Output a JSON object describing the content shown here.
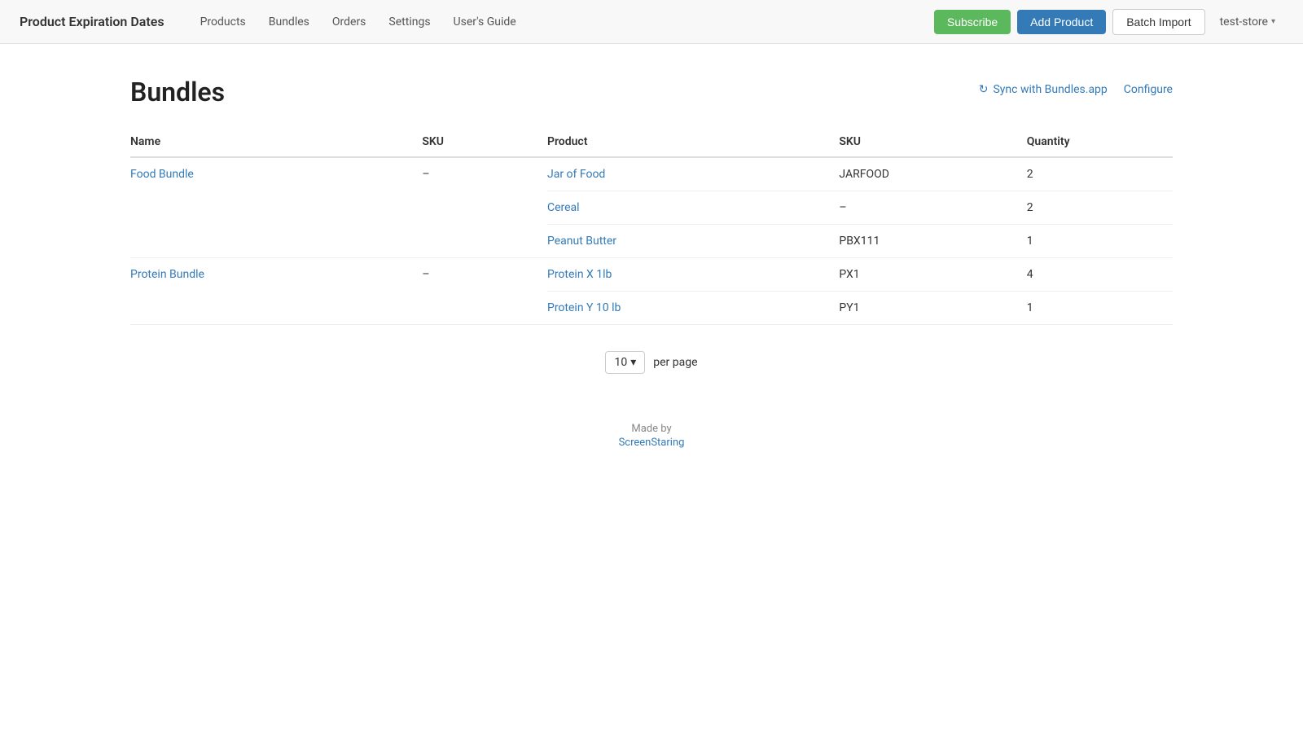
{
  "app": {
    "title": "Product Expiration Dates"
  },
  "nav": {
    "links": [
      {
        "label": "Products",
        "id": "products"
      },
      {
        "label": "Bundles",
        "id": "bundles"
      },
      {
        "label": "Orders",
        "id": "orders"
      },
      {
        "label": "Settings",
        "id": "settings"
      },
      {
        "label": "User's Guide",
        "id": "users-guide"
      }
    ]
  },
  "header_actions": {
    "subscribe_label": "Subscribe",
    "add_product_label": "Add Product",
    "batch_import_label": "Batch Import",
    "store_name": "test-store"
  },
  "page": {
    "title": "Bundles",
    "sync_label": "Sync with Bundles.app",
    "configure_label": "Configure"
  },
  "table": {
    "headers": {
      "name": "Name",
      "sku_bundle": "SKU",
      "product": "Product",
      "sku_product": "SKU",
      "quantity": "Quantity"
    },
    "rows": [
      {
        "bundle_name": "Food Bundle",
        "bundle_link": true,
        "bundle_sku": "–",
        "products": [
          {
            "name": "Jar of Food",
            "sku": "JARFOOD",
            "quantity": "2"
          },
          {
            "name": "Cereal",
            "sku": "–",
            "quantity": "2"
          },
          {
            "name": "Peanut Butter",
            "sku": "PBX111",
            "quantity": "1"
          }
        ]
      },
      {
        "bundle_name": "Protein Bundle",
        "bundle_link": true,
        "bundle_sku": "–",
        "products": [
          {
            "name": "Protein X 1lb",
            "sku": "PX1",
            "quantity": "4"
          },
          {
            "name": "Protein Y 10 lb",
            "sku": "PY1",
            "quantity": "1"
          }
        ]
      }
    ]
  },
  "pagination": {
    "per_page_value": "10",
    "per_page_label": "per page"
  },
  "footer": {
    "made_by_label": "Made by",
    "brand": "ScreenStaring"
  }
}
